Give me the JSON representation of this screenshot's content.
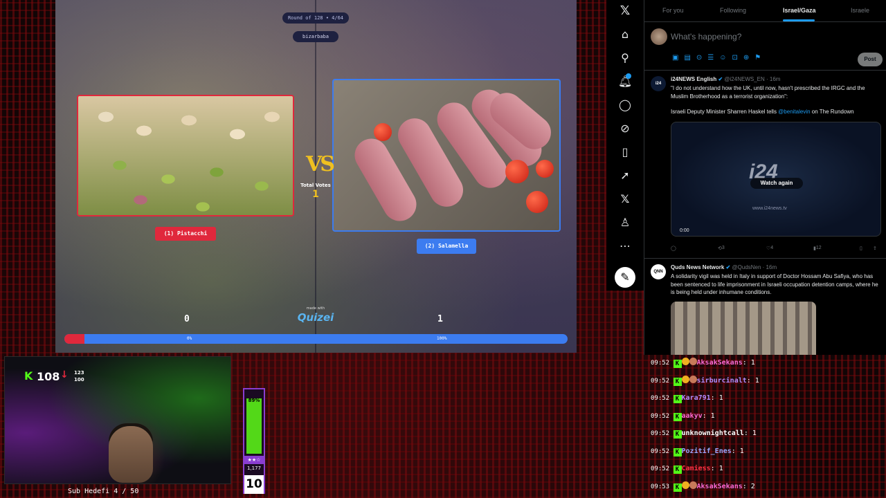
{
  "quiz": {
    "round_label": "Round of 128 • 4/64",
    "user_label": "bizarbaba",
    "vs_text": "VS",
    "total_votes_label": "Total Votes",
    "total_votes_value": "1",
    "option_left_label": "(1) Pistacchi",
    "option_right_label": "(2) Salamella",
    "score_left": "0",
    "score_right": "1",
    "made_with": "made with",
    "brand": "Quizei",
    "bar_left_pct_label": "0%",
    "bar_right_pct_label": "100%",
    "bar_left_fraction": 0.04,
    "colors": {
      "left": "#e0283c",
      "right": "#3c7cf0",
      "accent": "#f0c020"
    }
  },
  "x": {
    "nav_icons": [
      "x-logo-icon",
      "home-icon",
      "search-icon",
      "bell-icon",
      "messages-icon",
      "grok-icon",
      "bookmark-icon",
      "rocket-icon",
      "x-premium-icon",
      "profile-icon",
      "more-icon",
      "post-compose-icon"
    ],
    "tabs": [
      "For you",
      "Following",
      "Israel/Gaza",
      "Israele"
    ],
    "active_tab": "Israel/Gaza",
    "compose_placeholder": "What's happening?",
    "post_button": "Post",
    "tweets": [
      {
        "name": "i24NEWS English",
        "handle": "@i24NEWS_EN · 16m",
        "text1": "\"I do not understand how the UK, until now, hasn't prescribed the IRGC and the Muslim Brotherhood as a terrorist organization\":",
        "text2_a": "Israeli Deputy Minister Sharren Haskel tells ",
        "text2_link": "@benitalevin",
        "text2_b": " on The Rundown",
        "video_logo": "i24",
        "video_button": "Watch again",
        "video_url": "www.i24news.tv",
        "video_time": "0:00",
        "retweets": "3",
        "likes": "4",
        "views": "12"
      },
      {
        "name": "Quds News Network",
        "handle": "@QudsNen · 16m",
        "text": "A solidarity vigil was held in Italy in support of Doctor Hossam Abu Safiya, who has been sentenced to life imprisonment in Israeli occupation detention camps, where he is being held under inhumane conditions."
      }
    ]
  },
  "stream": {
    "kick_value": "108",
    "side_a": "123",
    "side_b": "100",
    "sub_goal": "Sub Hedefi 4 / 50",
    "meter_pct": "89%",
    "meter_fraction": 0.89,
    "meter_count": "1,177",
    "meter_big": "10",
    "accent_green": "#53fc18",
    "accent_purple": "#8a3dd0"
  },
  "chat": [
    {
      "time": "09:52",
      "user": "AksakSekans",
      "msg": "1",
      "color": "#ff6ad5",
      "badges": 2
    },
    {
      "time": "09:52",
      "user": "sirburcinalt",
      "msg": "1",
      "color": "#b48cff",
      "badges": 2
    },
    {
      "time": "09:52",
      "user": "Kara791",
      "msg": "1",
      "color": "#b48cff",
      "badges": 0
    },
    {
      "time": "09:52",
      "user": "aakyv",
      "msg": "1",
      "color": "#ff6ad5",
      "badges": 0
    },
    {
      "time": "09:52",
      "user": "unknownightcall",
      "msg": "1",
      "color": "#ffffff",
      "badges": 0
    },
    {
      "time": "09:52",
      "user": "Pozitif_Enes",
      "msg": "1",
      "color": "#9aa8ff",
      "badges": 0
    },
    {
      "time": "09:52",
      "user": "Camiess",
      "msg": "1",
      "color": "#ff3344",
      "badges": 0
    },
    {
      "time": "09:53",
      "user": "AksakSekans",
      "msg": "2",
      "color": "#ff6ad5",
      "badges": 2
    }
  ]
}
